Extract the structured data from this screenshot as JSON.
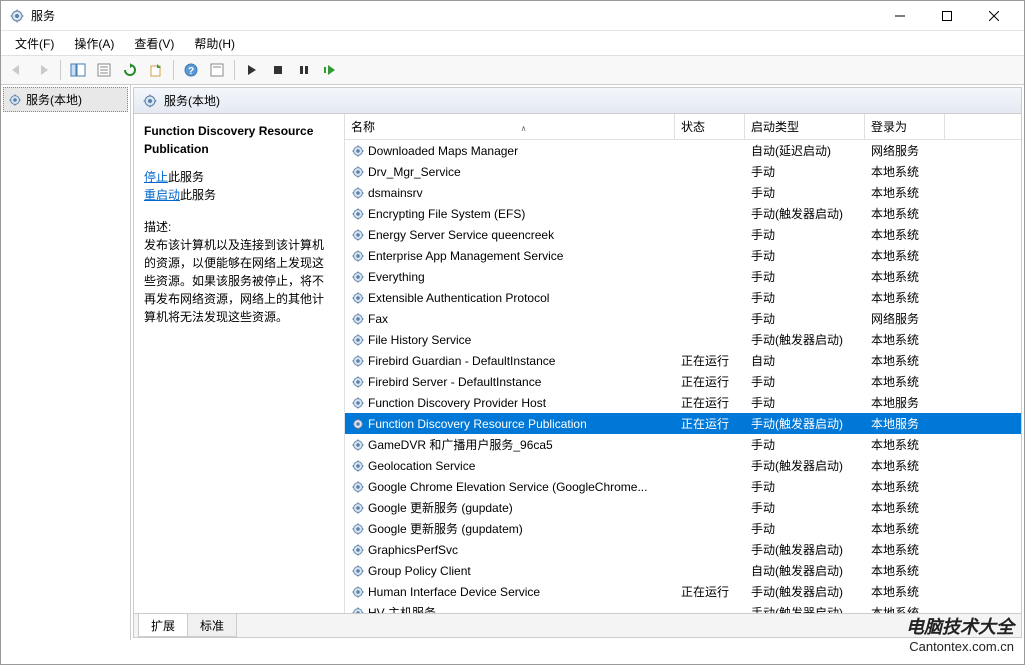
{
  "window": {
    "title": "服务"
  },
  "menu": {
    "file": "文件(F)",
    "action": "操作(A)",
    "view": "查看(V)",
    "help": "帮助(H)"
  },
  "tree": {
    "root": "服务(本地)"
  },
  "header": {
    "label": "服务(本地)"
  },
  "detail": {
    "name": "Function Discovery Resource Publication",
    "stop_link": "停止",
    "stop_suffix": "此服务",
    "restart_link": "重启动",
    "restart_suffix": "此服务",
    "desc_label": "描述:",
    "description": "发布该计算机以及连接到该计算机的资源，以便能够在网络上发现这些资源。如果该服务被停止，将不再发布网络资源，网络上的其他计算机将无法发现这些资源。"
  },
  "columns": {
    "name": "名称",
    "status": "状态",
    "startup": "启动类型",
    "logon": "登录为"
  },
  "services": [
    {
      "name": "Downloaded Maps Manager",
      "status": "",
      "startup": "自动(延迟启动)",
      "logon": "网络服务"
    },
    {
      "name": "Drv_Mgr_Service",
      "status": "",
      "startup": "手动",
      "logon": "本地系统"
    },
    {
      "name": "dsmainsrv",
      "status": "",
      "startup": "手动",
      "logon": "本地系统"
    },
    {
      "name": "Encrypting File System (EFS)",
      "status": "",
      "startup": "手动(触发器启动)",
      "logon": "本地系统"
    },
    {
      "name": "Energy Server Service queencreek",
      "status": "",
      "startup": "手动",
      "logon": "本地系统"
    },
    {
      "name": "Enterprise App Management Service",
      "status": "",
      "startup": "手动",
      "logon": "本地系统"
    },
    {
      "name": "Everything",
      "status": "",
      "startup": "手动",
      "logon": "本地系统"
    },
    {
      "name": "Extensible Authentication Protocol",
      "status": "",
      "startup": "手动",
      "logon": "本地系统"
    },
    {
      "name": "Fax",
      "status": "",
      "startup": "手动",
      "logon": "网络服务"
    },
    {
      "name": "File History Service",
      "status": "",
      "startup": "手动(触发器启动)",
      "logon": "本地系统"
    },
    {
      "name": "Firebird Guardian - DefaultInstance",
      "status": "正在运行",
      "startup": "自动",
      "logon": "本地系统"
    },
    {
      "name": "Firebird Server - DefaultInstance",
      "status": "正在运行",
      "startup": "手动",
      "logon": "本地系统"
    },
    {
      "name": "Function Discovery Provider Host",
      "status": "正在运行",
      "startup": "手动",
      "logon": "本地服务"
    },
    {
      "name": "Function Discovery Resource Publication",
      "status": "正在运行",
      "startup": "手动(触发器启动)",
      "logon": "本地服务",
      "selected": true
    },
    {
      "name": "GameDVR 和广播用户服务_96ca5",
      "status": "",
      "startup": "手动",
      "logon": "本地系统"
    },
    {
      "name": "Geolocation Service",
      "status": "",
      "startup": "手动(触发器启动)",
      "logon": "本地系统"
    },
    {
      "name": "Google Chrome Elevation Service (GoogleChrome...",
      "status": "",
      "startup": "手动",
      "logon": "本地系统"
    },
    {
      "name": "Google 更新服务 (gupdate)",
      "status": "",
      "startup": "手动",
      "logon": "本地系统"
    },
    {
      "name": "Google 更新服务 (gupdatem)",
      "status": "",
      "startup": "手动",
      "logon": "本地系统"
    },
    {
      "name": "GraphicsPerfSvc",
      "status": "",
      "startup": "手动(触发器启动)",
      "logon": "本地系统"
    },
    {
      "name": "Group Policy Client",
      "status": "",
      "startup": "自动(触发器启动)",
      "logon": "本地系统"
    },
    {
      "name": "Human Interface Device Service",
      "status": "正在运行",
      "startup": "手动(触发器启动)",
      "logon": "本地系统"
    },
    {
      "name": "HV 主机服务",
      "status": "",
      "startup": "手动(触发器启动)",
      "logon": "本地系统"
    }
  ],
  "tabs": {
    "extended": "扩展",
    "standard": "标准"
  },
  "watermark": {
    "main": "电脑技术大全",
    "sub": "Cantontex.com.cn"
  }
}
